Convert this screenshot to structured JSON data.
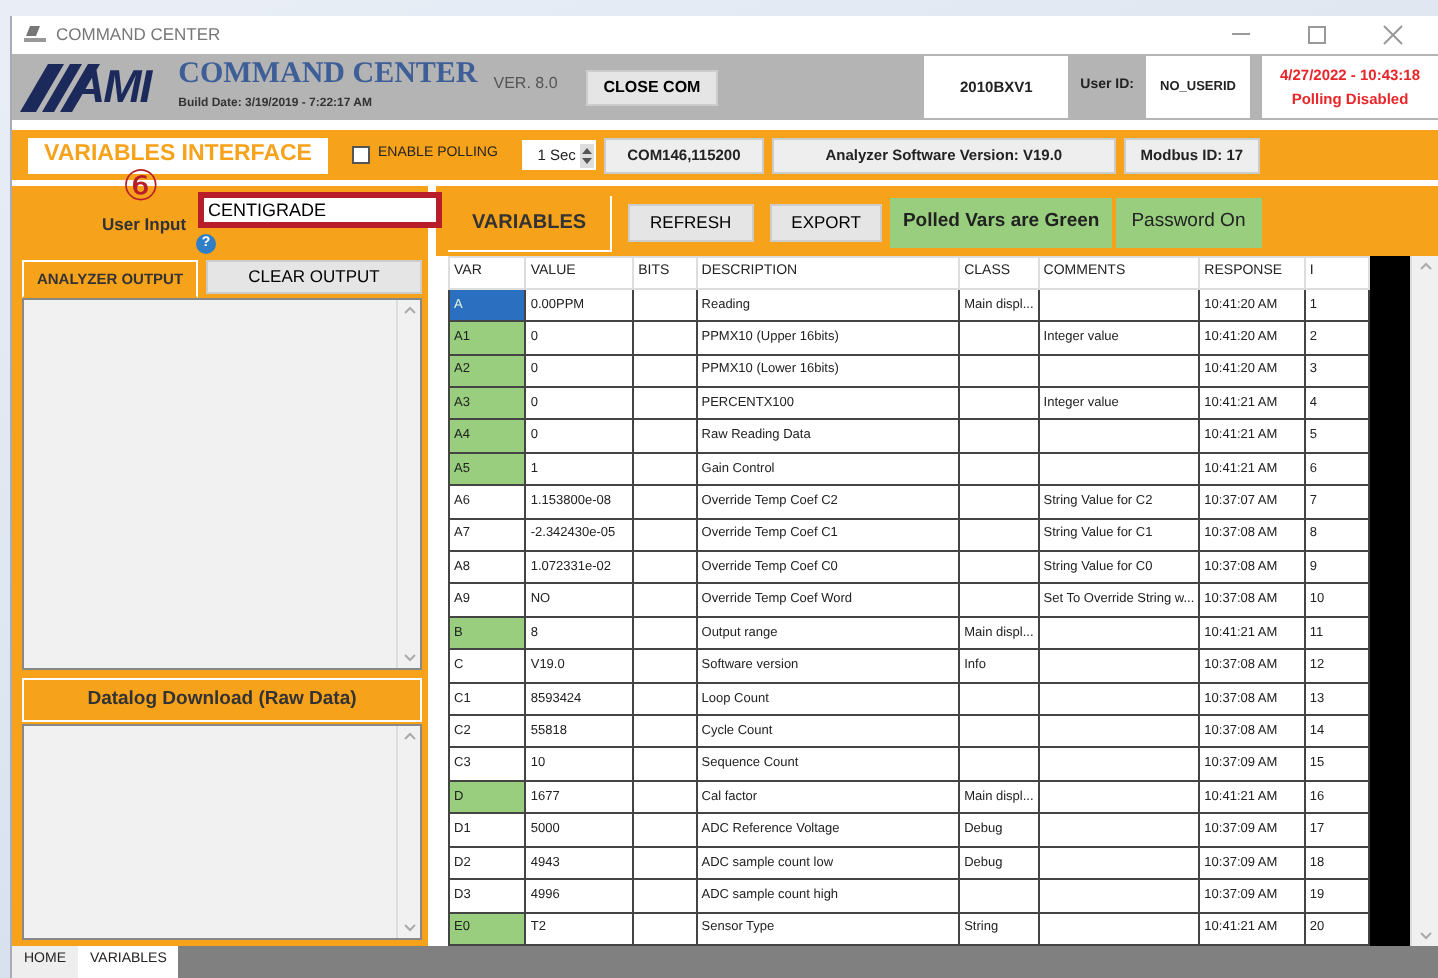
{
  "window": {
    "title": "COMMAND CENTER"
  },
  "header": {
    "logo": "AMI",
    "app_name": "COMMAND CENTER",
    "version": "VER. 8.0",
    "build_date": "Build Date:  3/19/2019 - 7:22:17 AM",
    "close_button": "CLOSE COM",
    "serial": "2010BXV1",
    "user_id_label": "User ID:",
    "user_id": "NO_USERID",
    "datetime": "4/27/2022 - 10:43:18",
    "polling_status": "Polling Disabled"
  },
  "toolbar": {
    "title": "VARIABLES INTERFACE",
    "enable_polling": {
      "label": "ENABLE POLLING",
      "checked": false
    },
    "interval": "1 Sec",
    "port": "COM146,115200",
    "software_version": "Analyzer Software Version: V19.0",
    "modbus_id": "Modbus ID: 17"
  },
  "user_input": {
    "label": "User Input",
    "value": "CENTIGRADE",
    "highlighted": true,
    "annotation": "⑥",
    "help": "?"
  },
  "left_panel": {
    "output_tab": "ANALYZER OUTPUT",
    "clear_button": "CLEAR OUTPUT",
    "datalog_title": "Datalog Download (Raw Data)"
  },
  "variables_bar": {
    "title": "VARIABLES",
    "buttons": [
      "REFRESH",
      "EXPORT"
    ],
    "legend": "Polled Vars are Green",
    "password": "Password On"
  },
  "table": {
    "columns": [
      "VAR",
      "VALUE",
      "BITS",
      "DESCRIPTION",
      "CLASS",
      "COMMENTS",
      "RESPONSE",
      "I"
    ],
    "rows": [
      {
        "var": "A",
        "value": "0.00PPM",
        "bits": "",
        "description": "Reading",
        "class": "Main displ...",
        "comments": "",
        "response": "10:41:20 AM",
        "i": "1",
        "polled": true,
        "selected": true
      },
      {
        "var": "A1",
        "value": "0",
        "bits": "",
        "description": "PPMX10 (Upper 16bits)",
        "class": "",
        "comments": "Integer value",
        "response": "10:41:20 AM",
        "i": "2",
        "polled": true,
        "selected": false
      },
      {
        "var": "A2",
        "value": "0",
        "bits": "",
        "description": "PPMX10 (Lower 16bits)",
        "class": "",
        "comments": "",
        "response": "10:41:20 AM",
        "i": "3",
        "polled": true,
        "selected": false
      },
      {
        "var": "A3",
        "value": "0",
        "bits": "",
        "description": "PERCENTX100",
        "class": "",
        "comments": "Integer value",
        "response": "10:41:21 AM",
        "i": "4",
        "polled": true,
        "selected": false
      },
      {
        "var": "A4",
        "value": "0",
        "bits": "",
        "description": "Raw Reading Data",
        "class": "",
        "comments": "",
        "response": "10:41:21 AM",
        "i": "5",
        "polled": true,
        "selected": false
      },
      {
        "var": "A5",
        "value": "1",
        "bits": "",
        "description": "Gain Control",
        "class": "",
        "comments": "",
        "response": "10:41:21 AM",
        "i": "6",
        "polled": true,
        "selected": false
      },
      {
        "var": "A6",
        "value": "1.153800e-08",
        "bits": "",
        "description": "Override Temp Coef C2",
        "class": "",
        "comments": "String Value for C2",
        "response": "10:37:07 AM",
        "i": "7",
        "polled": false,
        "selected": false
      },
      {
        "var": "A7",
        "value": "-2.342430e-05",
        "bits": "",
        "description": "Override Temp Coef C1",
        "class": "",
        "comments": "String Value for C1",
        "response": "10:37:08 AM",
        "i": "8",
        "polled": false,
        "selected": false
      },
      {
        "var": "A8",
        "value": "1.072331e-02",
        "bits": "",
        "description": "Override Temp Coef C0",
        "class": "",
        "comments": "String Value for C0",
        "response": "10:37:08 AM",
        "i": "9",
        "polled": false,
        "selected": false
      },
      {
        "var": "A9",
        "value": "NO",
        "bits": "",
        "description": "Override Temp Coef Word",
        "class": "",
        "comments": "Set To Override String w...",
        "response": "10:37:08 AM",
        "i": "10",
        "polled": false,
        "selected": false
      },
      {
        "var": "B",
        "value": "8",
        "bits": "",
        "description": "Output range",
        "class": "Main displ...",
        "comments": "",
        "response": "10:41:21 AM",
        "i": "11",
        "polled": true,
        "selected": false
      },
      {
        "var": "C",
        "value": "V19.0",
        "bits": "",
        "description": "Software version",
        "class": "Info",
        "comments": "",
        "response": "10:37:08 AM",
        "i": "12",
        "polled": false,
        "selected": false
      },
      {
        "var": "C1",
        "value": "8593424",
        "bits": "",
        "description": "Loop Count",
        "class": "",
        "comments": "",
        "response": "10:37:08 AM",
        "i": "13",
        "polled": false,
        "selected": false
      },
      {
        "var": "C2",
        "value": "55818",
        "bits": "",
        "description": "Cycle Count",
        "class": "",
        "comments": "",
        "response": "10:37:08 AM",
        "i": "14",
        "polled": false,
        "selected": false
      },
      {
        "var": "C3",
        "value": "10",
        "bits": "",
        "description": "Sequence Count",
        "class": "",
        "comments": "",
        "response": "10:37:09 AM",
        "i": "15",
        "polled": false,
        "selected": false
      },
      {
        "var": "D",
        "value": "1677",
        "bits": "",
        "description": "Cal factor",
        "class": "Main displ...",
        "comments": "",
        "response": "10:41:21 AM",
        "i": "16",
        "polled": true,
        "selected": false
      },
      {
        "var": "D1",
        "value": "5000",
        "bits": "",
        "description": "ADC Reference Voltage",
        "class": "Debug",
        "comments": "",
        "response": "10:37:09 AM",
        "i": "17",
        "polled": false,
        "selected": false
      },
      {
        "var": "D2",
        "value": "4943",
        "bits": "",
        "description": "ADC sample count low",
        "class": "Debug",
        "comments": "",
        "response": "10:37:09 AM",
        "i": "18",
        "polled": false,
        "selected": false
      },
      {
        "var": "D3",
        "value": "4996",
        "bits": "",
        "description": "ADC sample count high",
        "class": "",
        "comments": "",
        "response": "10:37:09 AM",
        "i": "19",
        "polled": false,
        "selected": false
      },
      {
        "var": "E0",
        "value": "T2",
        "bits": "",
        "description": "Sensor Type",
        "class": "String",
        "comments": "",
        "response": "10:41:21 AM",
        "i": "20",
        "polled": true,
        "selected": false
      }
    ]
  },
  "bottom_tabs": [
    {
      "label": "HOME",
      "selected": false
    },
    {
      "label": "VARIABLES",
      "selected": true
    }
  ]
}
